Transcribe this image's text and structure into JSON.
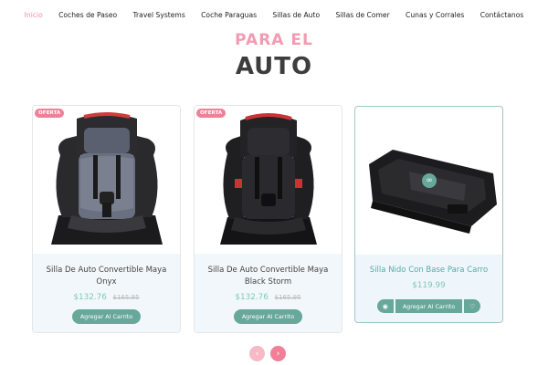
{
  "nav": {
    "items": [
      {
        "label": "Inicio",
        "active": true
      },
      {
        "label": "Coches de Paseo"
      },
      {
        "label": "Travel Systems"
      },
      {
        "label": "Coche Paraguas"
      },
      {
        "label": "Sillas de Auto"
      },
      {
        "label": "Sillas de Comer"
      },
      {
        "label": "Cunas y Corrales"
      },
      {
        "label": "Contáctanos"
      }
    ]
  },
  "section": {
    "title_top": "PARA EL",
    "title_main": "AUTO"
  },
  "products": [
    {
      "badge": "OFERTA",
      "title": "Silla De Auto Convertible Maya Onyx",
      "price": "$132.76",
      "old_price": "$165.95",
      "add_label": "Agregar Al Carrito",
      "image": "car-seat-gray"
    },
    {
      "badge": "OFERTA",
      "title": "Silla De Auto Convertible Maya Black Storm",
      "price": "$132.76",
      "old_price": "$165.95",
      "add_label": "Agregar Al Carrito",
      "image": "car-seat-black"
    },
    {
      "title": "Silla Nido Con Base Para Carro",
      "price": "$119.99",
      "add_label": "Agregar Al Carrito",
      "image": "car-seat-base",
      "view_icon": "eye-icon",
      "wishlist_icon": "heart-icon",
      "link_icon": "link-icon"
    }
  ],
  "pager": {
    "prev_icon": "chevron-left-icon",
    "next_icon": "chevron-right-icon",
    "prev_glyph": "‹",
    "next_glyph": "›"
  },
  "colors": {
    "accent_pink": "#f27f98",
    "heading_pink": "#f49ab3",
    "teal": "#67a89a",
    "price_green": "#7ccbb8"
  }
}
